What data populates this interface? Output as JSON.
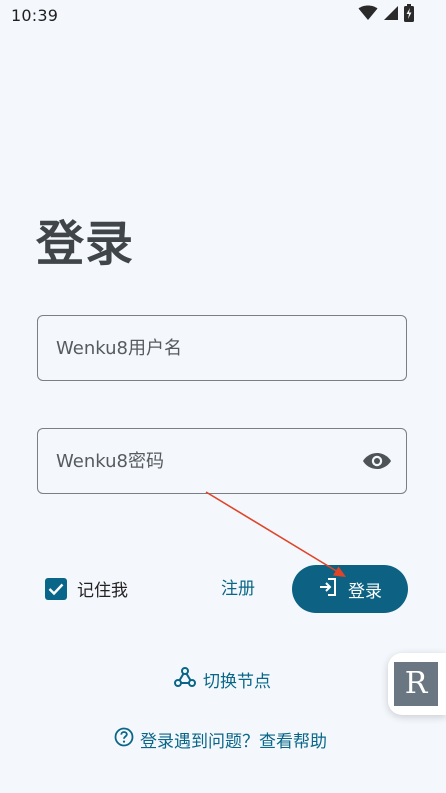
{
  "status_bar": {
    "time": "10:39",
    "icons": [
      "wifi-icon",
      "cellular-signal-icon",
      "battery-charging-icon"
    ]
  },
  "page": {
    "title": "登录"
  },
  "form": {
    "username_placeholder": "Wenku8用户名",
    "username_value": "",
    "password_placeholder": "Wenku8密码",
    "password_value": "",
    "password_toggle_icon": "eye-icon",
    "remember_label": "记住我",
    "remember_checked": true,
    "register_label": "注册",
    "login_label": "登录",
    "login_icon": "login-icon"
  },
  "links": {
    "switch_node_label": "切换节点",
    "switch_node_icon": "nodes-icon",
    "help_label": "登录遇到问题？查看帮助",
    "help_icon": "help-circle-icon"
  },
  "floating": {
    "letter": "R"
  },
  "colors": {
    "background": "#f4f8fc",
    "accent": "#0d6283",
    "title": "#3f4548",
    "annotation_arrow": "#e0452a"
  }
}
